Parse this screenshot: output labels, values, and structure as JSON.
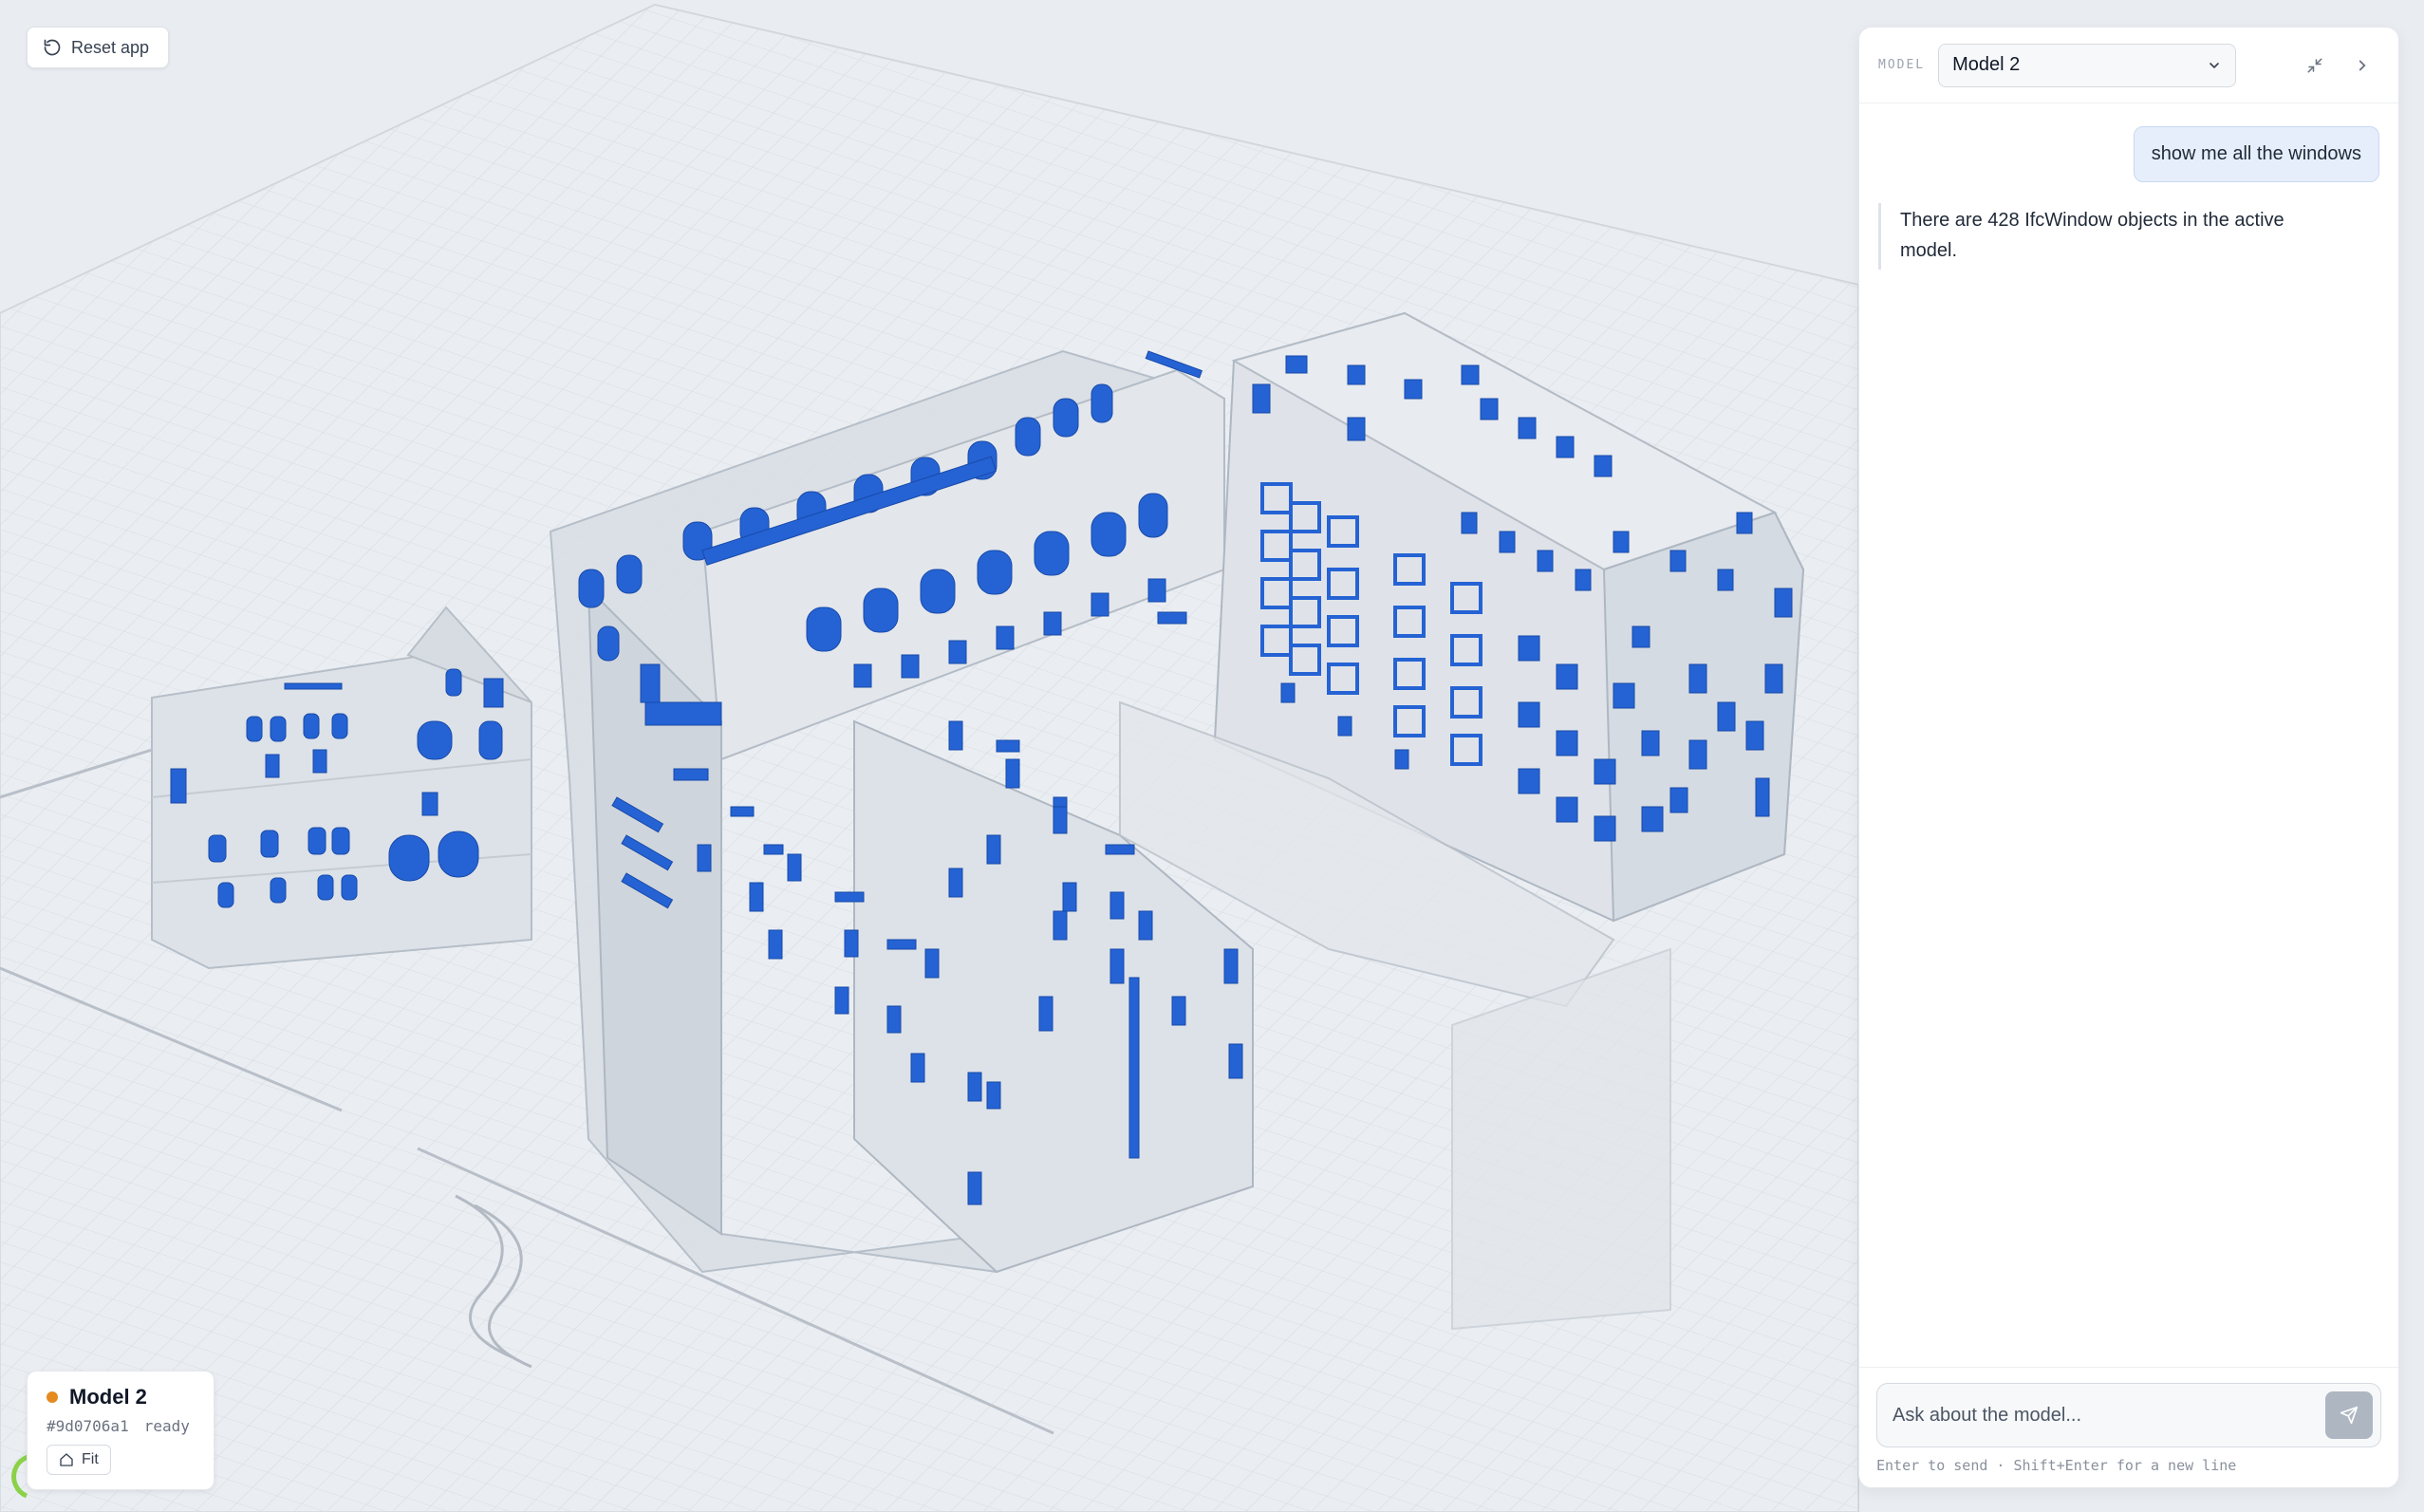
{
  "toolbar": {
    "reset_label": "Reset app"
  },
  "model_card": {
    "name": "Model 2",
    "hash": "#9d0706a1",
    "status": "ready",
    "fit_label": "Fit",
    "status_color": "#e58a1f"
  },
  "chat": {
    "model_label": "MODEL",
    "selected_model": "Model 2",
    "messages": [
      {
        "role": "user",
        "text": "show me all the windows"
      },
      {
        "role": "assistant",
        "text": "There are 428 IfcWindow objects in the active model."
      }
    ],
    "input_placeholder": "Ask about the model...",
    "hint": "Enter to send · Shift+Enter for a new line"
  },
  "colors": {
    "window_highlight": "#2563d4",
    "background": "#e9edf1"
  },
  "icons": {
    "reset": "rotate-ccw-icon",
    "fit": "home-icon",
    "dropdown": "chevron-down-icon",
    "collapse": "collapse-icon",
    "close": "chevron-right-icon",
    "send": "send-icon"
  }
}
